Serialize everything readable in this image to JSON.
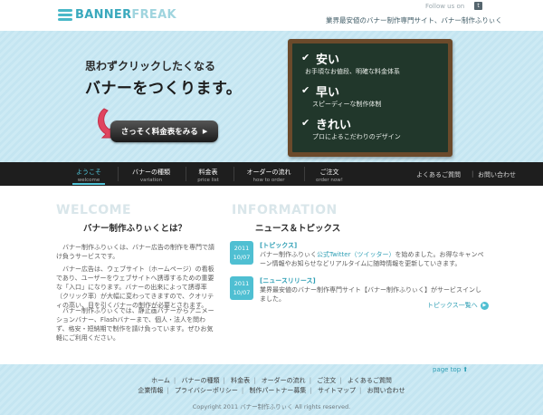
{
  "header": {
    "logo_banner": "BANNER",
    "logo_freak": "FREAK",
    "follow_label": "Follow us on",
    "tagline": "業界最安値のバナー制作専門サイト、バナー制作ふりぃく"
  },
  "hero": {
    "line1": "思わずクリックしたくなる",
    "line2": "バナーをつくります。",
    "cta_label": "さっそく料金表をみる",
    "board": [
      {
        "check": "✔",
        "head": "安い",
        "sub": "お手頃なお値段、明確な料金体系"
      },
      {
        "check": "✔",
        "head": "早い",
        "sub": "スピーディーな制作体制"
      },
      {
        "check": "✔",
        "head": "きれい",
        "sub": "プロによるこだわりのデザイン"
      }
    ],
    "colors": {
      "board_frame": "#6b4a2b",
      "board_surface": "#21372b",
      "hand_arrow": "#e0455f"
    }
  },
  "nav": {
    "items": [
      {
        "jp": "ようこそ",
        "en": "welcome"
      },
      {
        "jp": "バナーの種類",
        "en": "variation"
      },
      {
        "jp": "料金表",
        "en": "price list"
      },
      {
        "jp": "オーダーの流れ",
        "en": "how to order"
      },
      {
        "jp": "ご注文",
        "en": "order now!"
      }
    ],
    "faq": "よくあるご質問",
    "contact": "お問い合わせ",
    "accent_color": "#4fc2d6"
  },
  "welcome": {
    "ghost": "WELCOME",
    "title": "バナー制作ふりぃくとは？",
    "paragraphs": [
      "バナー制作ふりぃくは、バナー広告の制作を専門で請け負うサービスです。",
      "バナー広告は、ウェブサイト（ホームページ）の看板であり、ユーザーをウェブサイトへ誘導するための重要な「入口」になります。バナーの出来によって誘導率（クリック率）が大幅に変わってきますので、クオリティの高い、目を引くバナーの制作が必要とされます。",
      "バナー制作ふりぃくでは、静止画バナーからアニメーションバナー、Flashバナーまで、個人・法人を問わず、格安・短納期で制作を請け負っています。ぜひお気軽にご利用ください。"
    ]
  },
  "information": {
    "ghost": "INFORMATION",
    "title": "ニュース＆トピックス",
    "items": [
      {
        "year": "2011",
        "date": "10/07",
        "category": "[トピックス]",
        "text_pre": "バナー制作ふりぃく",
        "link": "公式Twitter（ツイッター）",
        "text_post": "を始めました。お得なキャンペーン情報やお知らせなどリアルタイムに随時情報を更新していきます。"
      },
      {
        "year": "2011",
        "date": "10/07",
        "category": "[ニュースリリース]",
        "text_pre": "業界最安値のバナー制作専門サイト【バナー制作ふりぃく】がサービスインしました。",
        "link": "",
        "text_post": ""
      }
    ],
    "more_label": "トピックス一覧へ",
    "more_icon": "chevron-right-icon"
  },
  "footer": {
    "pagetop": "page top",
    "pagetop_icon": "arrow-up-icon",
    "row1": [
      "ホーム",
      "バナーの種類",
      "料金表",
      "オーダーの流れ",
      "ご注文",
      "よくあるご質問"
    ],
    "row2": [
      "企業情報",
      "プライバシーポリシー",
      "制作パートナー募集",
      "サイトマップ",
      "お問い合わせ"
    ],
    "copyright": "Copyright 2011 バナー制作ふりぃく All rights reserved."
  }
}
